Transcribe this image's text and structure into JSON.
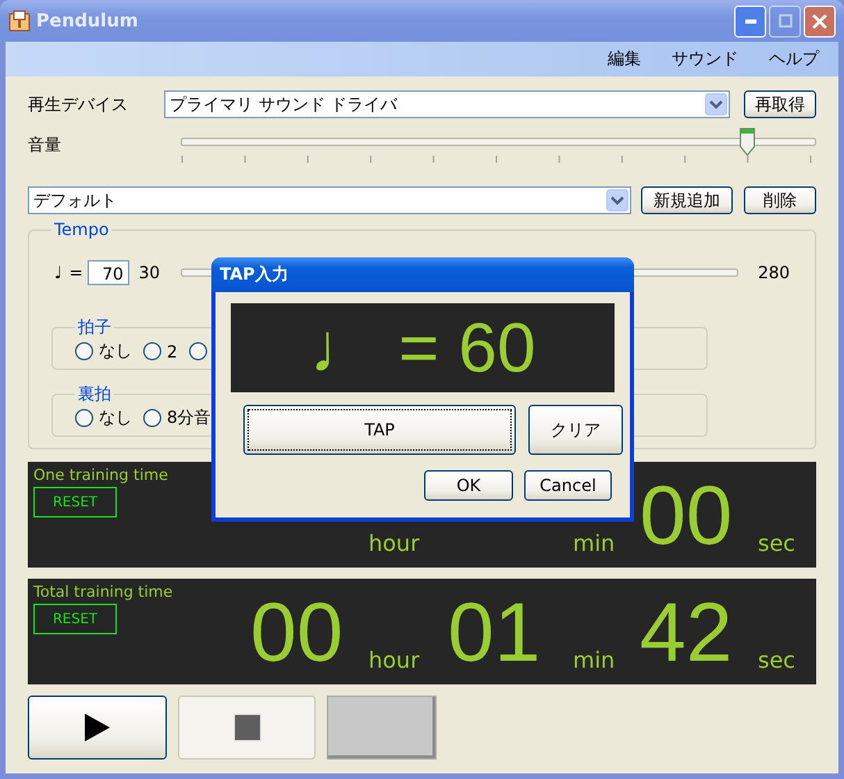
{
  "window": {
    "title": "Pendulum",
    "menu": [
      "編集",
      "サウンド",
      "ヘルプ"
    ]
  },
  "device": {
    "label": "再生デバイス",
    "value": "プライマリ サウンド ドライバ",
    "button": "再取得"
  },
  "volume": {
    "label": "音量",
    "level": 0.89
  },
  "preset": {
    "value": "デフォルト",
    "buttons": [
      "新規追加",
      "削除"
    ]
  },
  "tempo": {
    "title": "Tempo",
    "note": "♩",
    "equals": "=",
    "value": "70",
    "min": "30",
    "max": "280",
    "groups": [
      {
        "title": "拍子",
        "options": [
          {
            "label": "なし",
            "selected": false
          },
          {
            "label": "2",
            "selected": false
          },
          {
            "selected": false
          }
        ]
      },
      {
        "title": "裏拍",
        "options": [
          {
            "label": "なし",
            "selected": false
          },
          {
            "label": "8分音",
            "selected": false
          }
        ]
      }
    ]
  },
  "timers": [
    {
      "title": "One training time",
      "reset": "RESET",
      "hour_unit": "hour",
      "minute_unit": "min",
      "seconds": "00",
      "second_unit": "sec"
    },
    {
      "title": "Total training time",
      "reset": "RESET",
      "hours": "00",
      "hour_unit": "hour",
      "minutes": "01",
      "minute_unit": "min",
      "seconds": "42",
      "second_unit": "sec"
    }
  ],
  "transport": [
    {
      "kind": "play",
      "disabled": false
    },
    {
      "kind": "stop",
      "disabled": true
    },
    {
      "kind": "blank"
    }
  ],
  "dialog": {
    "title": "TAP入力",
    "display": "♩ = 60",
    "tap": "TAP",
    "clear": "クリア",
    "ok": "OK",
    "cancel": "Cancel"
  }
}
